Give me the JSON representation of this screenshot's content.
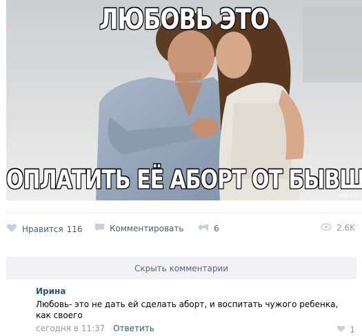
{
  "meme": {
    "caption_top": "ЛЮБОВЬ ЭТО",
    "caption_bottom": "ОПЛАТИТЬ ЕЁ АБОРТ ОТ БЫВШЕГО",
    "watermark": "kopy.ru"
  },
  "actions": {
    "like_label": "Нравится",
    "like_count": "116",
    "comment_label": "Комментировать",
    "share_count": "6",
    "views": "2.6K",
    "icons": [
      "heart-icon",
      "comment-icon",
      "share-icon",
      "eye-icon"
    ],
    "icon_color": "#c5d0db"
  },
  "comments_toggle": "Скрыть комментарии",
  "comment": {
    "author": "Ирина",
    "text": "Любовь- это не дать ей сделать аборт, и воспитать чужого ребенка, как своего",
    "time": "сегодня в 11:37",
    "reply_label": "Ответить",
    "likes": "1"
  }
}
